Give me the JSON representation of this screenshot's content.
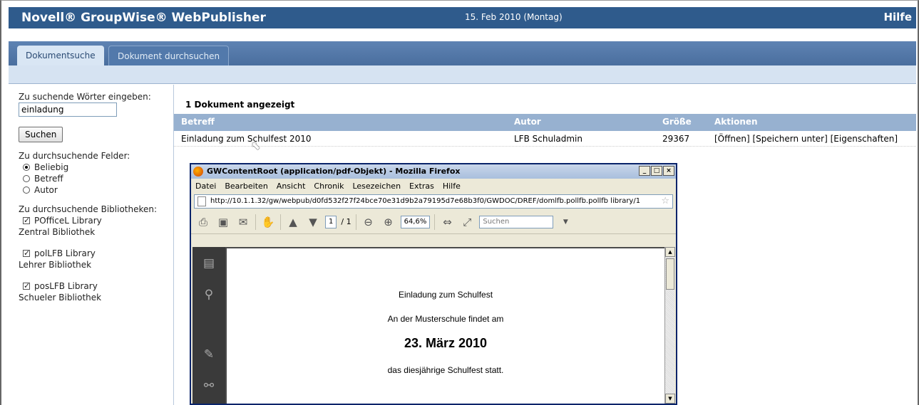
{
  "header": {
    "brand": "Novell® GroupWise® WebPublisher",
    "date": "15. Feb 2010 (Montag)",
    "help": "Hilfe"
  },
  "tabs": [
    {
      "label": "Dokumentsuche",
      "active": true
    },
    {
      "label": "Dokument durchsuchen",
      "active": false
    }
  ],
  "sidebar": {
    "search_label": "Zu suchende Wörter eingeben:",
    "search_value": "einladung",
    "search_button": "Suchen",
    "fields_label": "Zu durchsuchende Felder:",
    "fields": [
      {
        "label": "Beliebig",
        "selected": true
      },
      {
        "label": "Betreff",
        "selected": false
      },
      {
        "label": "Autor",
        "selected": false
      }
    ],
    "libraries_label": "Zu durchsuchende Bibliotheken:",
    "libraries": [
      {
        "name": "POfficeL Library",
        "desc": "Zentral Bibliothek",
        "checked": true
      },
      {
        "name": "polLFB Library",
        "desc": "Lehrer Bibliothek",
        "checked": true
      },
      {
        "name": "posLFB Library",
        "desc": "Schueler Bibliothek",
        "checked": true
      }
    ]
  },
  "results": {
    "count_text": "1 Dokument angezeigt",
    "columns": [
      "Betreff",
      "Autor",
      "Größe",
      "Aktionen"
    ],
    "rows": [
      {
        "subject": "Einladung zum Schulfest 2010",
        "author": "LFB Schuladmin",
        "size": "29367",
        "actions": [
          "[Öffnen]",
          "[Speichern unter]",
          "[Eigenschaften]"
        ]
      }
    ]
  },
  "popup": {
    "title": "GWContentRoot (application/pdf-Objekt) - Mozilla Firefox",
    "menu": [
      "Datei",
      "Bearbeiten",
      "Ansicht",
      "Chronik",
      "Lesezeichen",
      "Extras",
      "Hilfe"
    ],
    "url": "http://10.1.1.32/gw/webpub/d0fd532f27f24bce70e31d9b2a79195d7e68b3f0/GWDOC/DREF/domlfb.pollfb.pollfb library/1",
    "page_current": "1",
    "page_total": "/ 1",
    "zoom": "64,6%",
    "search_placeholder": "Suchen",
    "pdf": {
      "line1": "Einladung zum Schulfest",
      "line2": "An der Musterschule findet am",
      "line3": "23. März 2010",
      "line4": "das diesjährige Schulfest statt."
    }
  }
}
